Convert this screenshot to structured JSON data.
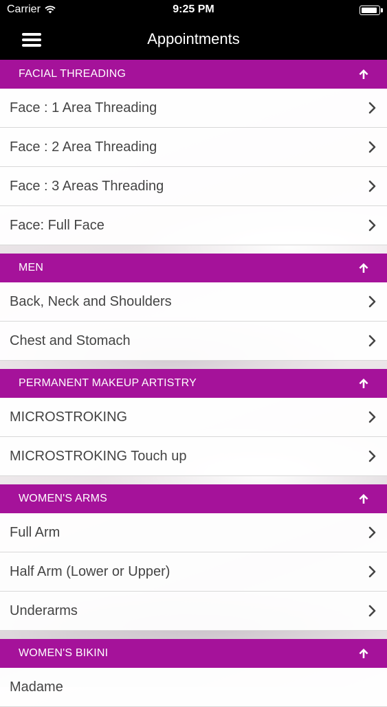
{
  "status_bar": {
    "carrier": "Carrier",
    "time": "9:25 PM",
    "battery_level": 0.9
  },
  "nav": {
    "title": "Appointments",
    "menu_icon": "hamburger-menu-icon"
  },
  "sections": [
    {
      "title": "FACIAL THREADING",
      "items": [
        "Face : 1 Area Threading",
        "Face : 2 Area Threading",
        "Face : 3 Areas Threading",
        "Face: Full Face"
      ]
    },
    {
      "title": "MEN",
      "items": [
        "Back, Neck and Shoulders",
        "Chest and Stomach"
      ]
    },
    {
      "title": "PERMANENT MAKEUP ARTISTRY",
      "items": [
        "MICROSTROKING",
        "MICROSTROKING Touch up"
      ]
    },
    {
      "title": "WOMEN'S ARMS",
      "items": [
        "Full Arm",
        "Half Arm (Lower or Upper)",
        "Underarms"
      ]
    },
    {
      "title": "WOMEN'S BIKINI",
      "items": [
        "Madame"
      ]
    }
  ],
  "colors": {
    "accent": "#a5129a",
    "nav_bg": "#000000",
    "row_text": "#444444"
  }
}
